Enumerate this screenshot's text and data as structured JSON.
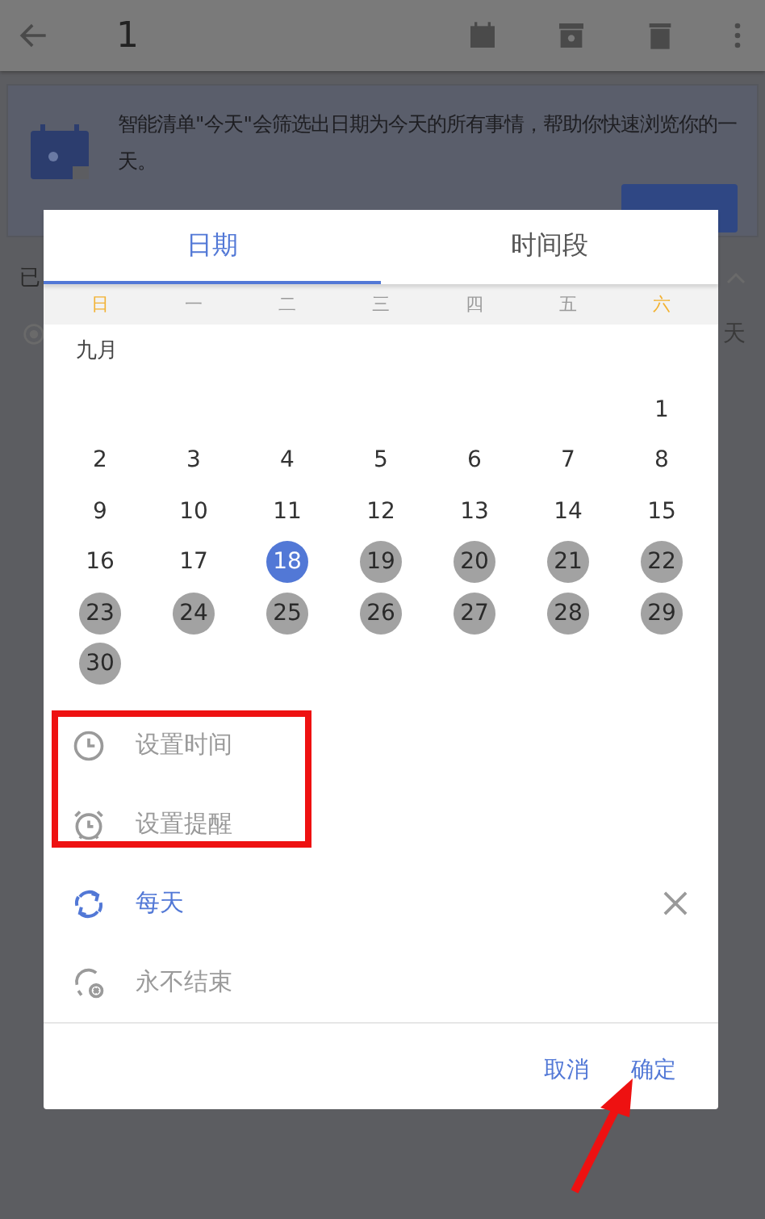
{
  "header": {
    "title": "1"
  },
  "banner": {
    "text": "智能清单\"今天\"会筛选出日期为今天的所有事情，帮助你快速浏览你的一天。",
    "button_visible": true
  },
  "section": {
    "label": "已"
  },
  "task": {
    "text": "天"
  },
  "dialog": {
    "tabs": [
      {
        "label": "日期",
        "selected": true
      },
      {
        "label": "时间段",
        "selected": false
      }
    ],
    "weekdays": [
      {
        "label": "日",
        "weekend": true
      },
      {
        "label": "一",
        "weekend": false
      },
      {
        "label": "二",
        "weekend": false
      },
      {
        "label": "三",
        "weekend": false
      },
      {
        "label": "四",
        "weekend": false
      },
      {
        "label": "五",
        "weekend": false
      },
      {
        "label": "六",
        "weekend": true
      }
    ],
    "month": "九月",
    "weeks": [
      [
        {
          "day": "1",
          "selected": false,
          "marked": false
        }
      ],
      [
        {
          "day": "2",
          "selected": false,
          "marked": false
        },
        {
          "day": "3",
          "selected": false,
          "marked": false
        },
        {
          "day": "4",
          "selected": false,
          "marked": false
        },
        {
          "day": "5",
          "selected": false,
          "marked": false
        },
        {
          "day": "6",
          "selected": false,
          "marked": false
        },
        {
          "day": "7",
          "selected": false,
          "marked": false
        },
        {
          "day": "8",
          "selected": false,
          "marked": false
        }
      ],
      [
        {
          "day": "9",
          "selected": false,
          "marked": false
        },
        {
          "day": "10",
          "selected": false,
          "marked": false
        },
        {
          "day": "11",
          "selected": false,
          "marked": false
        },
        {
          "day": "12",
          "selected": false,
          "marked": false
        },
        {
          "day": "13",
          "selected": false,
          "marked": false
        },
        {
          "day": "14",
          "selected": false,
          "marked": false
        },
        {
          "day": "15",
          "selected": false,
          "marked": false
        }
      ],
      [
        {
          "day": "16",
          "selected": false,
          "marked": false
        },
        {
          "day": "17",
          "selected": false,
          "marked": false
        },
        {
          "day": "18",
          "selected": true,
          "marked": false
        },
        {
          "day": "19",
          "selected": false,
          "marked": true
        },
        {
          "day": "20",
          "selected": false,
          "marked": true
        },
        {
          "day": "21",
          "selected": false,
          "marked": true
        },
        {
          "day": "22",
          "selected": false,
          "marked": true
        }
      ],
      [
        {
          "day": "23",
          "selected": false,
          "marked": true
        },
        {
          "day": "24",
          "selected": false,
          "marked": true
        },
        {
          "day": "25",
          "selected": false,
          "marked": true
        },
        {
          "day": "26",
          "selected": false,
          "marked": true
        },
        {
          "day": "27",
          "selected": false,
          "marked": true
        },
        {
          "day": "28",
          "selected": false,
          "marked": true
        },
        {
          "day": "29",
          "selected": false,
          "marked": true
        }
      ],
      [
        {
          "day": "30",
          "selected": false,
          "marked": true
        }
      ]
    ],
    "options": [
      {
        "kind": "time",
        "label": "设置时间",
        "active": false
      },
      {
        "kind": "reminder",
        "label": "设置提醒",
        "active": false
      },
      {
        "kind": "repeat",
        "label": "每天",
        "active": true
      },
      {
        "kind": "end",
        "label": "永不结束",
        "active": false
      }
    ],
    "buttons": [
      "取消",
      "确定"
    ]
  }
}
